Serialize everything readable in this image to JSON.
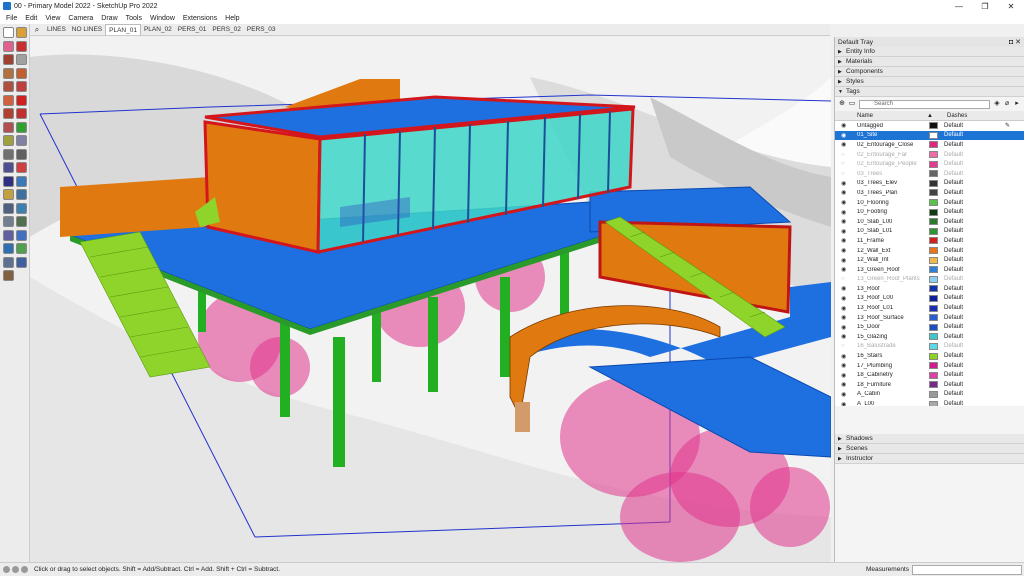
{
  "window": {
    "title": "00 - Primary Model 2022 - SketchUp Pro 2022",
    "minimize": "—",
    "maximize": "❐",
    "close": "✕"
  },
  "menu": [
    "File",
    "Edit",
    "View",
    "Camera",
    "Draw",
    "Tools",
    "Window",
    "Extensions",
    "Help"
  ],
  "scenes": {
    "search_icon": "search-icon",
    "tabs": [
      "LINES",
      "NO LINES",
      "PLAN_01",
      "PLAN_02",
      "PERS_01",
      "PERS_02",
      "PERS_03"
    ],
    "active": "PLAN_01"
  },
  "tray": {
    "title": "Default Tray",
    "controls": "◘ ✕",
    "sections_top": [
      {
        "label": "Entity Info",
        "state": "collapsed"
      },
      {
        "label": "Materials",
        "state": "collapsed"
      },
      {
        "label": "Components",
        "state": "collapsed"
      },
      {
        "label": "Styles",
        "state": "collapsed"
      },
      {
        "label": "Tags",
        "state": "expanded"
      }
    ],
    "tags": {
      "search_placeholder": "Search",
      "header_name": "Name",
      "header_sort": "▲",
      "header_dashes": "Dashes",
      "rows": [
        {
          "name": "Untagged",
          "color": "#111111",
          "dash": "Default",
          "visible": true,
          "selected": false,
          "pencil": true
        },
        {
          "name": "01_Site",
          "color": "#ffffff",
          "dash": "Default",
          "visible": true,
          "selected": true
        },
        {
          "name": "02_Entourage_Close",
          "color": "#e0267f",
          "dash": "Default",
          "visible": true,
          "selected": false
        },
        {
          "name": "02_Entourage_Far",
          "color": "#f06aa8",
          "dash": "Default",
          "visible": false,
          "selected": false
        },
        {
          "name": "02_Entourage_People",
          "color": "#e53993",
          "dash": "Default",
          "visible": false,
          "selected": false
        },
        {
          "name": "03_Trees",
          "color": "#666666",
          "dash": "Default",
          "visible": false,
          "selected": false
        },
        {
          "name": "03_Trees_Elev",
          "color": "#333333",
          "dash": "Default",
          "visible": true,
          "selected": false
        },
        {
          "name": "03_Trees_Plan",
          "color": "#444444",
          "dash": "Default",
          "visible": true,
          "selected": false
        },
        {
          "name": "10_Flooring",
          "color": "#57c447",
          "dash": "Default",
          "visible": true,
          "selected": false
        },
        {
          "name": "10_Footing",
          "color": "#0f3d12",
          "dash": "Default",
          "visible": true,
          "selected": false
        },
        {
          "name": "10_Slab_L00",
          "color": "#2b7a2b",
          "dash": "Default",
          "visible": true,
          "selected": false
        },
        {
          "name": "10_Slab_L01",
          "color": "#2d9637",
          "dash": "Default",
          "visible": true,
          "selected": false
        },
        {
          "name": "11_Frame",
          "color": "#d12020",
          "dash": "Default",
          "visible": true,
          "selected": false
        },
        {
          "name": "12_Wall_Ext",
          "color": "#e8741c",
          "dash": "Default",
          "visible": true,
          "selected": false
        },
        {
          "name": "12_Wall_Int",
          "color": "#f2b84a",
          "dash": "Default",
          "visible": true,
          "selected": false
        },
        {
          "name": "13_Green_Roof",
          "color": "#2f7fd6",
          "dash": "Default",
          "visible": true,
          "selected": false
        },
        {
          "name": "13_Green_Roof_Plants",
          "color": "#8ad0f0",
          "dash": "Default",
          "visible": false,
          "selected": false
        },
        {
          "name": "13_Roof",
          "color": "#1133aa",
          "dash": "Default",
          "visible": true,
          "selected": false
        },
        {
          "name": "13_Roof_L00",
          "color": "#10209a",
          "dash": "Default",
          "visible": true,
          "selected": false
        },
        {
          "name": "13_Roof_L01",
          "color": "#1a2db8",
          "dash": "Default",
          "visible": true,
          "selected": false
        },
        {
          "name": "13_Roof_Surface",
          "color": "#2a5fd0",
          "dash": "Default",
          "visible": true,
          "selected": false
        },
        {
          "name": "15_Door",
          "color": "#1d4fc4",
          "dash": "Default",
          "visible": true,
          "selected": false
        },
        {
          "name": "15_Glazing",
          "color": "#3ec9c9",
          "dash": "Default",
          "visible": true,
          "selected": false
        },
        {
          "name": "16_Balustrade",
          "color": "#5ad8e8",
          "dash": "Default",
          "visible": false,
          "selected": false
        },
        {
          "name": "16_Stairs",
          "color": "#8bd41e",
          "dash": "Default",
          "visible": true,
          "selected": false
        },
        {
          "name": "17_Plumbing",
          "color": "#d31c8f",
          "dash": "Default",
          "visible": true,
          "selected": false
        },
        {
          "name": "18_Cabinetry",
          "color": "#e03fa5",
          "dash": "Default",
          "visible": true,
          "selected": false
        },
        {
          "name": "18_Furniture",
          "color": "#7a2a8a",
          "dash": "Default",
          "visible": true,
          "selected": false
        },
        {
          "name": "A_Cabin",
          "color": "#9a9a9a",
          "dash": "Default",
          "visible": true,
          "selected": false
        },
        {
          "name": "A_L00",
          "color": "#a8a8a8",
          "dash": "Default",
          "visible": true,
          "selected": false
        },
        {
          "name": "A_L01",
          "color": "#b5b5b5",
          "dash": "Default",
          "visible": true,
          "selected": false
        }
      ]
    },
    "sections_bottom": [
      {
        "label": "Shadows"
      },
      {
        "label": "Scenes"
      },
      {
        "label": "Instructor"
      }
    ]
  },
  "status": {
    "message": "Click or drag to select objects. Shift = Add/Subtract. Ctrl = Add. Shift + Ctrl = Subtract.",
    "measurements_label": "Measurements",
    "measurements_value": ""
  },
  "colors": {
    "roof_blue": "#1e6fe0",
    "frame_red": "#d3161c",
    "wall_orange": "#e07a10",
    "glazing": "#3ed6c8",
    "stairs_green": "#8fd42a",
    "column_green": "#22b022",
    "entourage_pink": "#e0358c",
    "bounding_blue": "#2233cc"
  }
}
